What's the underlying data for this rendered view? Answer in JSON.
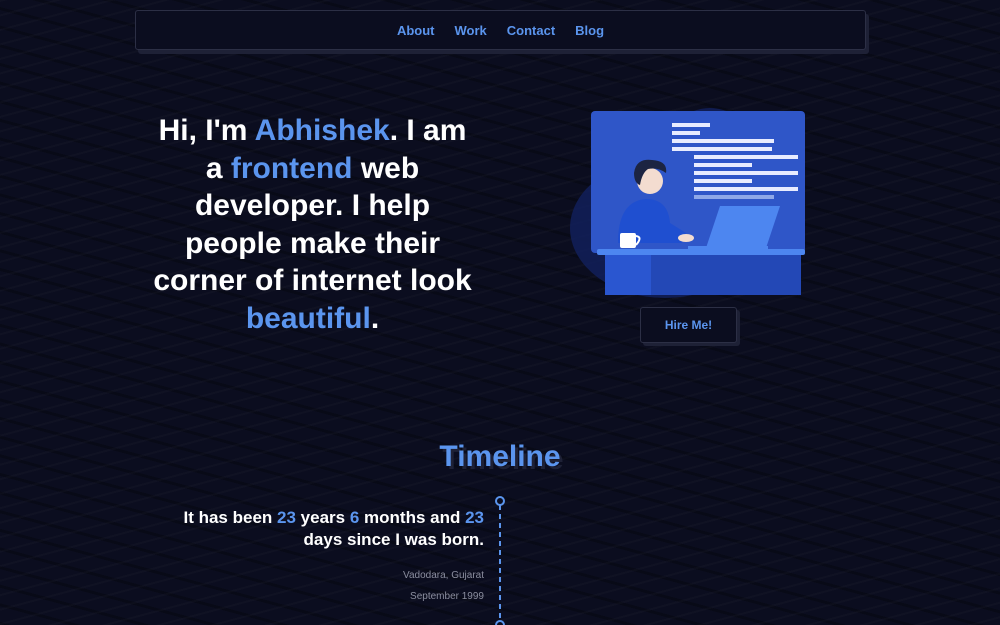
{
  "nav": {
    "items": [
      "About",
      "Work",
      "Contact",
      "Blog"
    ]
  },
  "hero": {
    "t1": "Hi, I'm ",
    "name": "Abhishek",
    "t2": ". I am a ",
    "role": "frontend",
    "t3": " web developer. I help people make their corner of internet look ",
    "adj": "beautiful",
    "t4": "."
  },
  "hire_button": "Hire Me!",
  "timeline": {
    "title": "Timeline",
    "entry": {
      "p1": "It has been ",
      "years": "23",
      "p2": " years ",
      "months": "6",
      "p3": " months and ",
      "days": "23",
      "p4": " days since I was born.",
      "location": "Vadodara, Gujarat",
      "date": "September 1999"
    }
  },
  "colors": {
    "accent": "#5b95ee",
    "background": "#0b0d1f"
  }
}
